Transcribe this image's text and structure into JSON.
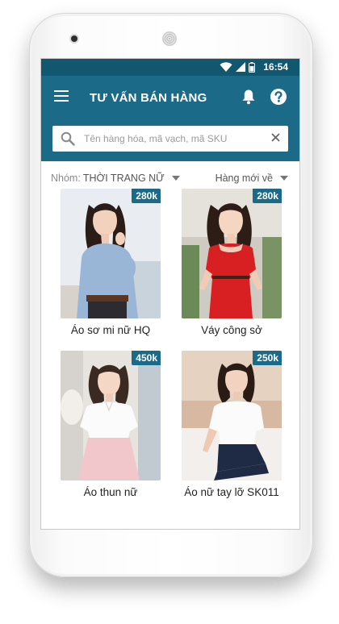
{
  "status_bar": {
    "time": "16:54"
  },
  "app_bar": {
    "title": "TƯ VẤN BÁN HÀNG"
  },
  "search": {
    "placeholder": "Tên hàng hóa, mã vạch, mã SKU",
    "value": ""
  },
  "filters": {
    "group_label": "Nhóm:",
    "group_value": "THỜI TRANG NỮ",
    "sort_value": "Hàng mới về"
  },
  "products": [
    {
      "name": "Áo sơ mi nữ HQ",
      "price": "280k"
    },
    {
      "name": "Váy công sở",
      "price": "280k"
    },
    {
      "name": "Áo thun nữ",
      "price": "450k"
    },
    {
      "name": "Áo nữ tay lỡ SK011",
      "price": "250k"
    }
  ],
  "colors": {
    "primary": "#1a6a88",
    "status_bar": "#10576f"
  }
}
